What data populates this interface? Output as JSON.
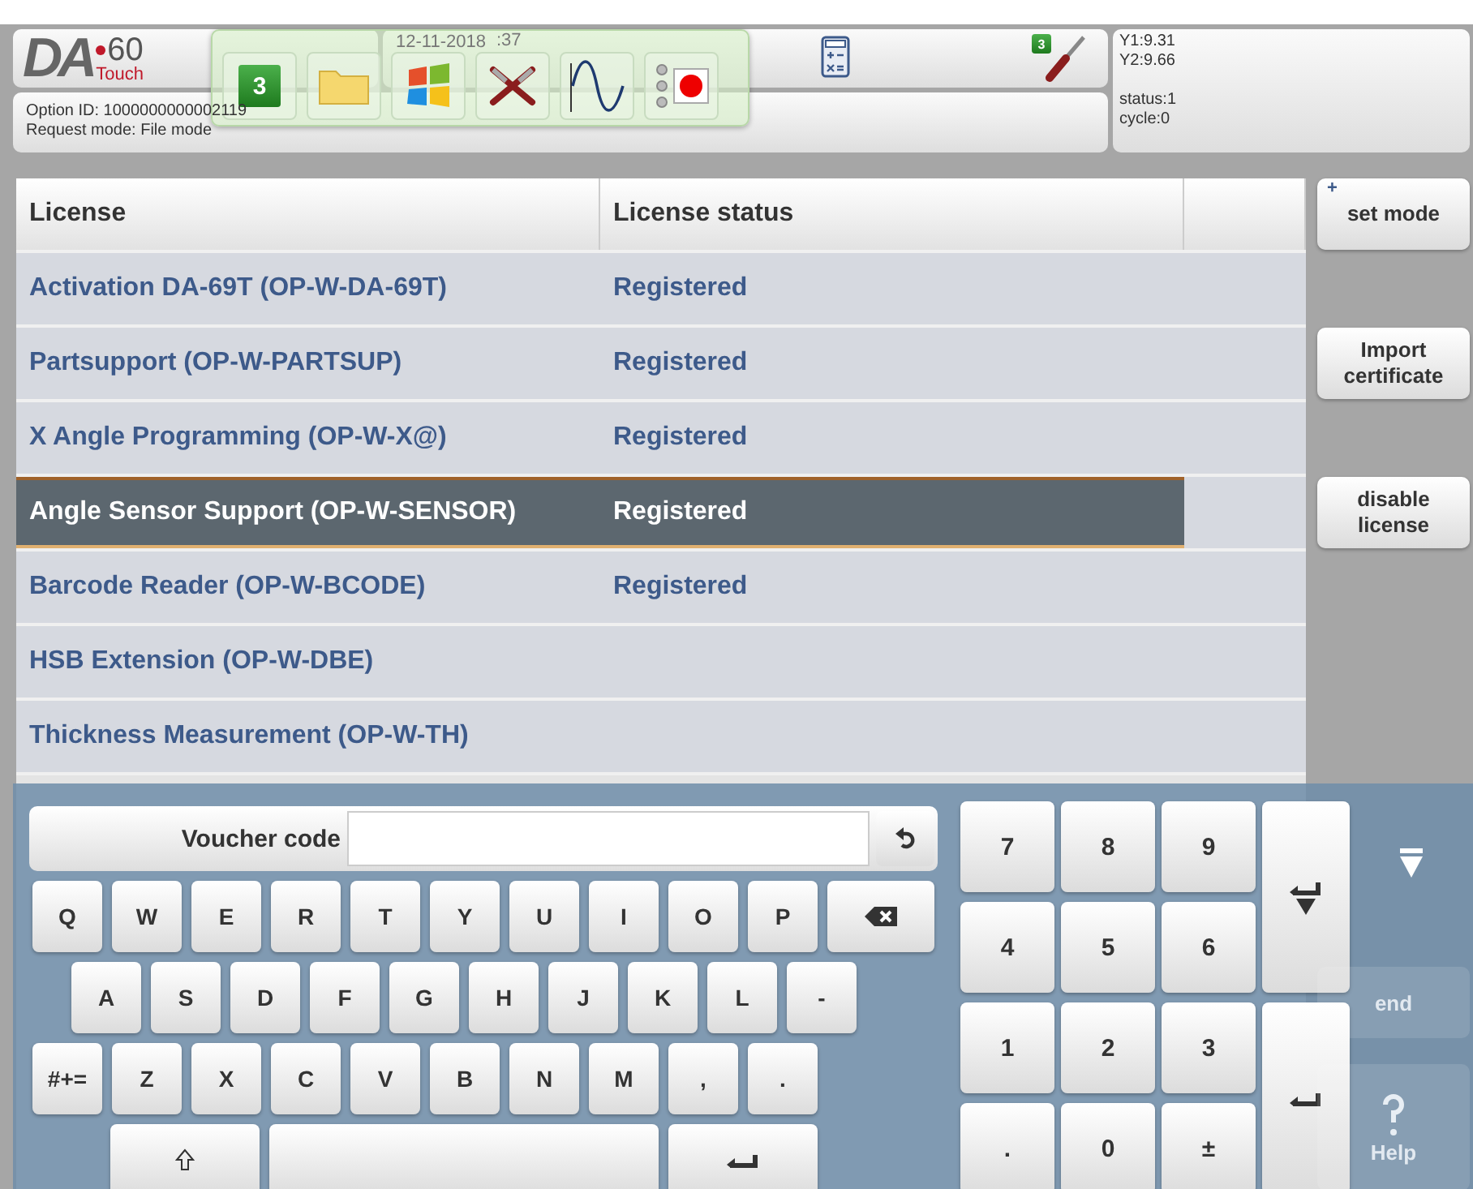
{
  "header": {
    "logo": {
      "letters": "DA",
      "number": "60",
      "sub": "Touch"
    },
    "date": "12-11-2018",
    "time": ":37",
    "option_id": "Option ID: 1000000000002119",
    "request_mode": "Request mode: File mode",
    "tool_badge": "3",
    "status": [
      "Y1:9.31",
      "Y2:9.66",
      "status:1",
      "cycle:0"
    ]
  },
  "toolbar": {
    "badge": "3",
    "record_on": true
  },
  "table": {
    "columns": [
      "License",
      "License status"
    ],
    "rows": [
      {
        "license": "Activation DA-69T (OP-W-DA-69T)",
        "status": "Registered",
        "selected": false
      },
      {
        "license": "Partsupport (OP-W-PARTSUP)",
        "status": "Registered",
        "selected": false
      },
      {
        "license": "X Angle Programming (OP-W-X@)",
        "status": "Registered",
        "selected": false
      },
      {
        "license": "Angle Sensor Support (OP-W-SENSOR)",
        "status": "Registered",
        "selected": true
      },
      {
        "license": "Barcode Reader (OP-W-BCODE)",
        "status": "Registered",
        "selected": false
      },
      {
        "license": "HSB Extension (OP-W-DBE)",
        "selected": false
      },
      {
        "license": "Thickness Measurement (OP-W-TH)",
        "selected": false
      }
    ]
  },
  "side_buttons": [
    {
      "label": "set mode",
      "mark": "+"
    },
    {
      "label": "Import certificate"
    },
    {
      "label": "disable license"
    }
  ],
  "dim_buttons": [
    "end",
    "Help"
  ],
  "keyboard": {
    "field_label": "Voucher code",
    "rows": [
      [
        {
          "kind": "char",
          "label": "Q"
        },
        {
          "kind": "char",
          "label": "W"
        },
        {
          "kind": "char",
          "label": "E"
        },
        {
          "kind": "char",
          "label": "R"
        },
        {
          "kind": "char",
          "label": "T"
        },
        {
          "kind": "char",
          "label": "Y"
        },
        {
          "kind": "char",
          "label": "U"
        },
        {
          "kind": "char",
          "label": "I"
        },
        {
          "kind": "char",
          "label": "O"
        },
        {
          "kind": "char",
          "label": "P"
        },
        {
          "kind": "backspace"
        }
      ],
      [
        {
          "kind": "char",
          "label": "A"
        },
        {
          "kind": "char",
          "label": "S"
        },
        {
          "kind": "char",
          "label": "D"
        },
        {
          "kind": "char",
          "label": "F"
        },
        {
          "kind": "char",
          "label": "G"
        },
        {
          "kind": "char",
          "label": "H"
        },
        {
          "kind": "char",
          "label": "J"
        },
        {
          "kind": "char",
          "label": "K"
        },
        {
          "kind": "char",
          "label": "L"
        },
        {
          "kind": "char",
          "label": "-"
        }
      ],
      [
        {
          "kind": "char",
          "label": "#+="
        },
        {
          "kind": "char",
          "label": "Z"
        },
        {
          "kind": "char",
          "label": "X"
        },
        {
          "kind": "char",
          "label": "C"
        },
        {
          "kind": "char",
          "label": "V"
        },
        {
          "kind": "char",
          "label": "B"
        },
        {
          "kind": "char",
          "label": "N"
        },
        {
          "kind": "char",
          "label": "M"
        },
        {
          "kind": "char",
          "label": ","
        },
        {
          "kind": "char",
          "label": "."
        }
      ],
      [
        {
          "kind": "shift"
        },
        {
          "kind": "space"
        },
        {
          "kind": "enter"
        }
      ]
    ],
    "numpad": [
      "7",
      "8",
      "9",
      "4",
      "5",
      "6",
      "1",
      "2",
      "3",
      ".",
      "0",
      "±"
    ]
  }
}
